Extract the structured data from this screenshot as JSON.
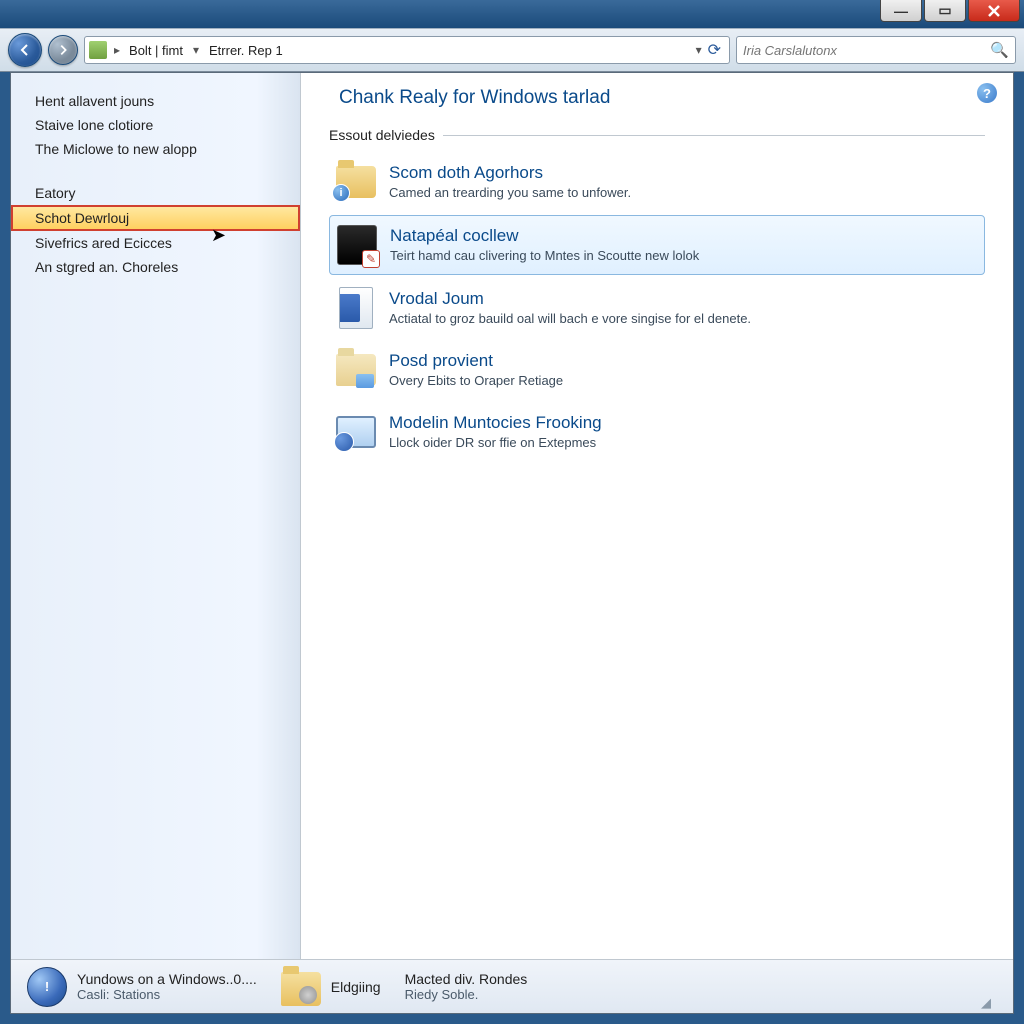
{
  "breadcrumb": {
    "segments": [
      "Bolt | fimt",
      "Etrrer. Rep 1"
    ]
  },
  "search": {
    "placeholder": "Iria Carslalutonx"
  },
  "sidebar": {
    "groups": [
      {
        "items": [
          {
            "label": "Hent allavent jouns"
          },
          {
            "label": "Staive lone clotiore"
          },
          {
            "label": "The Miclowe to new alopp"
          }
        ]
      },
      {
        "items": [
          {
            "label": "Eatory"
          },
          {
            "label": "Schot Dewrlouj",
            "selected": true
          },
          {
            "label": "Sivefrics ared Ecicces"
          },
          {
            "label": "An stgred an. Choreles"
          }
        ]
      }
    ]
  },
  "main": {
    "page_title": "Chank Realy for Windows tarlad",
    "section": "Essout delviedes",
    "items": [
      {
        "icon": "folder-info",
        "title": "Scom doth Agorhors",
        "desc": "Camed an trearding you same to unfower."
      },
      {
        "icon": "black-box",
        "title": "Natapéal cocllew",
        "desc": "Teirt hamd cau clivering to Mntes in Scoutte new lolok",
        "highlighted": true
      },
      {
        "icon": "doc-blue",
        "title": "Vrodal Joum",
        "desc": "Actiatal to groz bauild oal will bach e vore singise for el denete."
      },
      {
        "icon": "folder-tool",
        "title": "Posd provient",
        "desc": "Overy Ebits to Oraper Retiage"
      },
      {
        "icon": "monitor",
        "title": "Modelin Muntocies Frooking",
        "desc": "Llock oider DR sor ffie on Extepmes"
      }
    ]
  },
  "statusbar": {
    "items": [
      {
        "icon": "orb",
        "line1": "Yundows on a Windows..0....",
        "line2": "Casli: Stations"
      },
      {
        "icon": "folder",
        "line1": "Eldgiing",
        "line2": ""
      },
      {
        "icon": "none",
        "line1": "Macted div. Rondes",
        "line2": "Riedy Soble."
      }
    ]
  }
}
